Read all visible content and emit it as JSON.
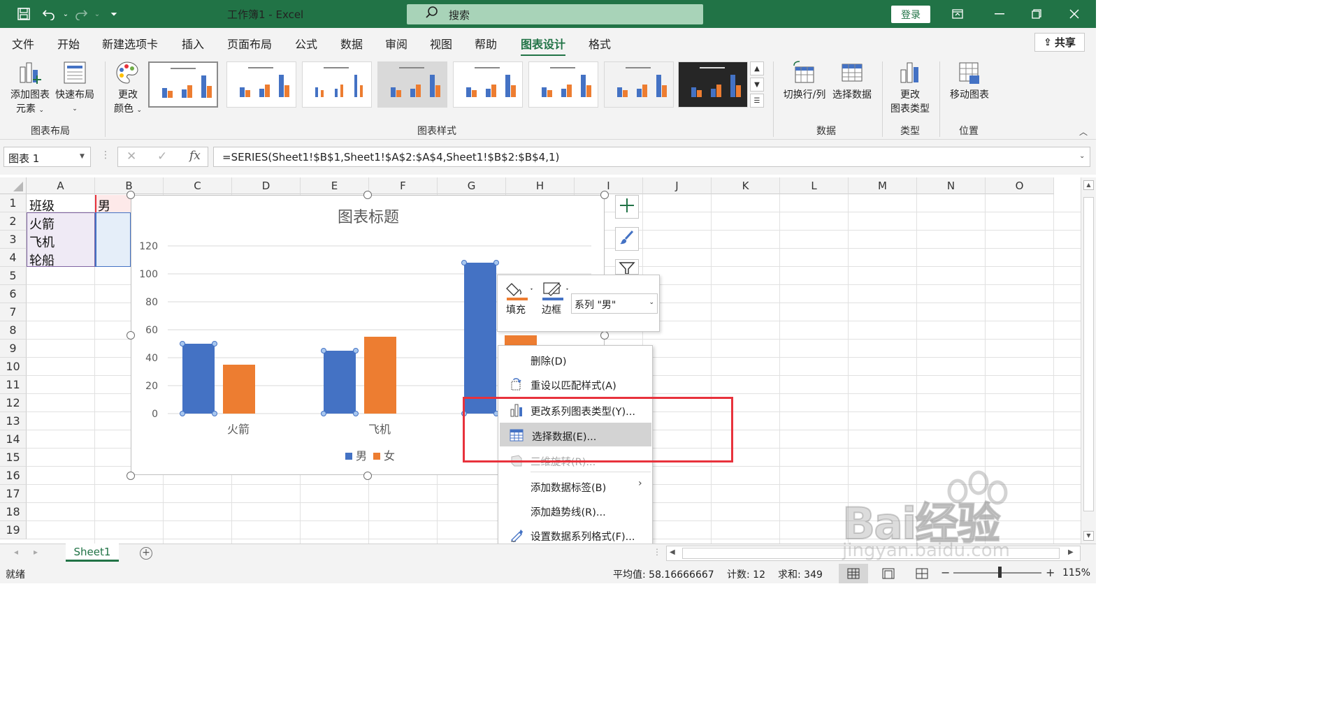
{
  "window": {
    "title": "工作簿1  -  Excel",
    "search_placeholder": "搜索",
    "login": "登录"
  },
  "menu_tabs": [
    "文件",
    "开始",
    "新建选项卡",
    "插入",
    "页面布局",
    "公式",
    "数据",
    "审阅",
    "视图",
    "帮助",
    "图表设计",
    "格式"
  ],
  "active_tab": "图表设计",
  "share": "共享",
  "ribbon": {
    "add_element": [
      "添加图表",
      "元素"
    ],
    "quick_layout": "快速布局",
    "change_color": [
      "更改",
      "颜色"
    ],
    "group_layout": "图表布局",
    "group_styles": "图表样式",
    "switch_rowcol": "切换行/列",
    "select_data": "选择数据",
    "group_data": "数据",
    "change_type": [
      "更改",
      "图表类型"
    ],
    "group_type": "类型",
    "move_chart": "移动图表",
    "group_location": "位置"
  },
  "formula_bar": {
    "name_box": "图表 1",
    "formula": "=SERIES(Sheet1!$B$1,Sheet1!$A$2:$A$4,Sheet1!$B$2:$B$4,1)"
  },
  "columns": [
    "A",
    "B",
    "C",
    "D",
    "E",
    "F",
    "G",
    "H",
    "I",
    "J",
    "K",
    "L",
    "M",
    "N",
    "O"
  ],
  "rows": [
    "1",
    "2",
    "3",
    "4",
    "5",
    "6",
    "7",
    "8",
    "9",
    "10",
    "11",
    "12",
    "13",
    "14",
    "15",
    "16",
    "17",
    "18",
    "19"
  ],
  "cells": {
    "A1": "班级",
    "B1": "男",
    "A2": "火箭",
    "A3": "飞机",
    "A4": "轮船"
  },
  "chart_data": {
    "type": "bar",
    "title": "图表标题",
    "categories": [
      "火箭",
      "飞机",
      "轮船"
    ],
    "visible_category_labels": [
      "火箭",
      "飞机"
    ],
    "series": [
      {
        "name": "男",
        "values": [
          50,
          45,
          108
        ],
        "color": "#4472c4"
      },
      {
        "name": "女",
        "values": [
          35,
          55,
          56
        ],
        "color": "#ed7d31"
      }
    ],
    "y_ticks": [
      "0",
      "20",
      "40",
      "60",
      "80",
      "100",
      "120"
    ],
    "ylim": [
      0,
      120
    ],
    "grid": true,
    "legend": "bottom"
  },
  "mini_toolbar": {
    "fill": "填充",
    "border": "边框",
    "series_select": "系列 \"男\""
  },
  "context_menu": [
    {
      "label": "删除(D)",
      "accel": "D",
      "icon": "none",
      "state": "normal"
    },
    {
      "label": "重设以匹配样式(A)",
      "accel": "A",
      "icon": "reset-style-icon",
      "state": "normal"
    },
    {
      "label": "更改系列图表类型(Y)...",
      "accel": "Y",
      "icon": "chart-type-icon",
      "state": "normal"
    },
    {
      "label": "选择数据(E)...",
      "accel": "E",
      "icon": "select-data-icon",
      "state": "hover"
    },
    {
      "label": "三维旋转(R)...",
      "accel": "R",
      "icon": "rotate-3d-icon",
      "state": "disabled"
    },
    {
      "label": "添加数据标签(B)",
      "accel": "B",
      "icon": "none",
      "state": "submenu"
    },
    {
      "label": "添加趋势线(R)...",
      "accel": "R",
      "icon": "none",
      "state": "normal"
    },
    {
      "label": "设置数据系列格式(F)...",
      "accel": "F",
      "icon": "format-series-icon",
      "state": "normal"
    }
  ],
  "sheet_tab": "Sheet1",
  "status": {
    "mode": "就绪",
    "average": "平均值: 58.16666667",
    "count": "计数: 12",
    "sum": "求和: 349",
    "zoom": "115%"
  },
  "colors": {
    "accent": "#217346",
    "highlight": "#e8323c",
    "series_male": "#4472c4",
    "series_female": "#ed7d31"
  },
  "watermark": {
    "brand": "Bai经验",
    "url": "jingyan.baidu.com"
  }
}
